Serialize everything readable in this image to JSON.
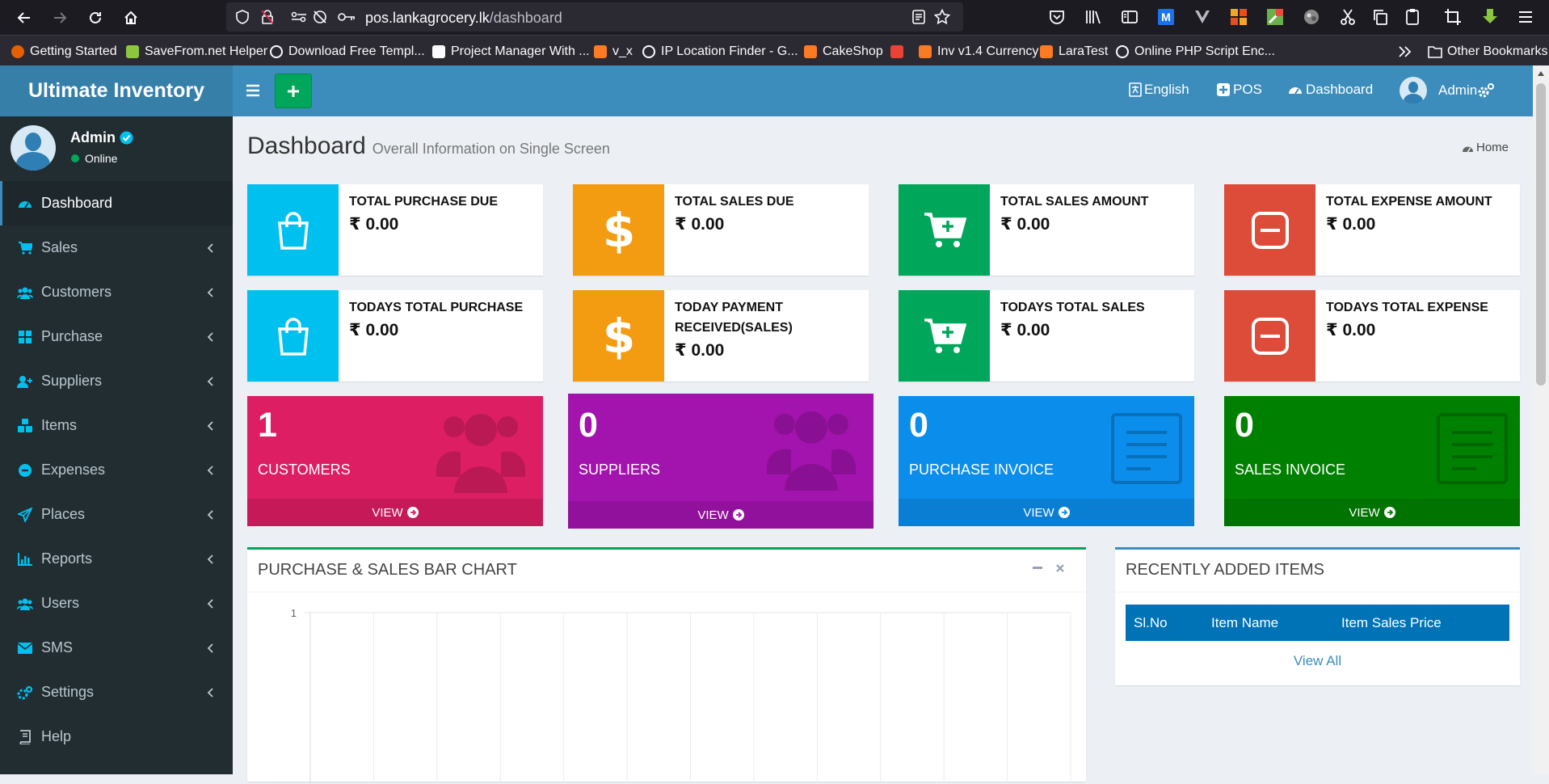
{
  "browser": {
    "url_host": "pos.lankagrocery.lk",
    "url_path": "/dashboard",
    "bookmarks": [
      {
        "label": "Getting Started",
        "icon": "firefox-icon"
      },
      {
        "label": "SaveFrom.net Helper",
        "icon": "download-arrow-icon"
      },
      {
        "label": "Download Free Templ...",
        "icon": "globe-icon"
      },
      {
        "label": "Project Manager With ...",
        "icon": "page-icon"
      },
      {
        "label": "v_x",
        "icon": "xampp-icon"
      },
      {
        "label": "IP Location Finder - G...",
        "icon": "globe-icon"
      },
      {
        "label": "CakeShop",
        "icon": "xampp-icon"
      },
      {
        "label": "",
        "icon": "gmail-icon"
      },
      {
        "label": "Inv v1.4 Currency",
        "icon": "xampp-icon"
      },
      {
        "label": "LaraTest",
        "icon": "xampp-icon"
      },
      {
        "label": "Online PHP Script Enc...",
        "icon": "globe-icon"
      }
    ],
    "other_bookmarks": "Other Bookmarks"
  },
  "brand": {
    "name": "Ultimate Inventory"
  },
  "topbar": {
    "language": "English",
    "pos": "POS",
    "dashboard": "Dashboard",
    "user": "Admin"
  },
  "sidebar": {
    "user_name": "Admin",
    "user_status": "Online",
    "items": [
      {
        "label": "Dashboard",
        "icon": "dashboard-icon"
      },
      {
        "label": "Sales",
        "icon": "cart-icon"
      },
      {
        "label": "Customers",
        "icon": "users-icon"
      },
      {
        "label": "Purchase",
        "icon": "grid-icon"
      },
      {
        "label": "Suppliers",
        "icon": "user-plus-icon"
      },
      {
        "label": "Items",
        "icon": "cubes-icon"
      },
      {
        "label": "Expenses",
        "icon": "minus-circle-icon"
      },
      {
        "label": "Places",
        "icon": "paper-plane-icon"
      },
      {
        "label": "Reports",
        "icon": "bar-chart-icon"
      },
      {
        "label": "Users",
        "icon": "users-icon"
      },
      {
        "label": "SMS",
        "icon": "envelope-icon"
      },
      {
        "label": "Settings",
        "icon": "cogs-icon"
      },
      {
        "label": "Help",
        "icon": "book-icon"
      }
    ]
  },
  "page": {
    "title": "Dashboard",
    "subtitle": "Overall Information on Single Screen",
    "breadcrumb": "Home"
  },
  "info_boxes": [
    {
      "label": "TOTAL PURCHASE DUE",
      "value": "₹ 0.00",
      "color": "#00c0ef",
      "icon": "shopping-bag-icon"
    },
    {
      "label": "TOTAL SALES DUE",
      "value": "₹ 0.00",
      "color": "#f39c12",
      "icon": "dollar-icon"
    },
    {
      "label": "TOTAL SALES AMOUNT",
      "value": "₹ 0.00",
      "color": "#00a65a",
      "icon": "cart-plus-icon"
    },
    {
      "label": "TOTAL EXPENSE AMOUNT",
      "value": "₹ 0.00",
      "color": "#dd4b39",
      "icon": "minus-square-icon"
    },
    {
      "label": "TODAYS TOTAL PURCHASE",
      "value": "₹ 0.00",
      "color": "#00c0ef",
      "icon": "shopping-bag-icon"
    },
    {
      "label": "TODAY PAYMENT RECEIVED(SALES)",
      "value": "₹ 0.00",
      "color": "#f39c12",
      "icon": "dollar-icon"
    },
    {
      "label": "TODAYS TOTAL SALES",
      "value": "₹ 0.00",
      "color": "#00a65a",
      "icon": "cart-plus-icon"
    },
    {
      "label": "TODAYS TOTAL EXPENSE",
      "value": "₹ 0.00",
      "color": "#dd4b39",
      "icon": "minus-square-icon"
    }
  ],
  "small_boxes": [
    {
      "count": "1",
      "label": "CUSTOMERS",
      "link": "VIEW",
      "color": "#dd1e62",
      "icon": "users-icon"
    },
    {
      "count": "0",
      "label": "SUPPLIERS",
      "link": "VIEW",
      "color": "#a313ae",
      "icon": "users-icon"
    },
    {
      "count": "0",
      "label": "PURCHASE INVOICE",
      "link": "VIEW",
      "color": "#0b8deb",
      "icon": "file-text-icon"
    },
    {
      "count": "0",
      "label": "SALES INVOICE",
      "link": "VIEW",
      "color": "#008000",
      "icon": "file-text-icon"
    }
  ],
  "chart_panel": {
    "title": "PURCHASE & SALES BAR CHART"
  },
  "chart_data": {
    "type": "bar",
    "title": "PURCHASE & SALES BAR CHART",
    "y_ticks": [
      "1"
    ],
    "grid": true
  },
  "recent_items": {
    "title": "RECENTLY ADDED ITEMS",
    "columns": [
      "Sl.No",
      "Item Name",
      "Item Sales Price"
    ],
    "rows": [],
    "view_all": "View All"
  }
}
